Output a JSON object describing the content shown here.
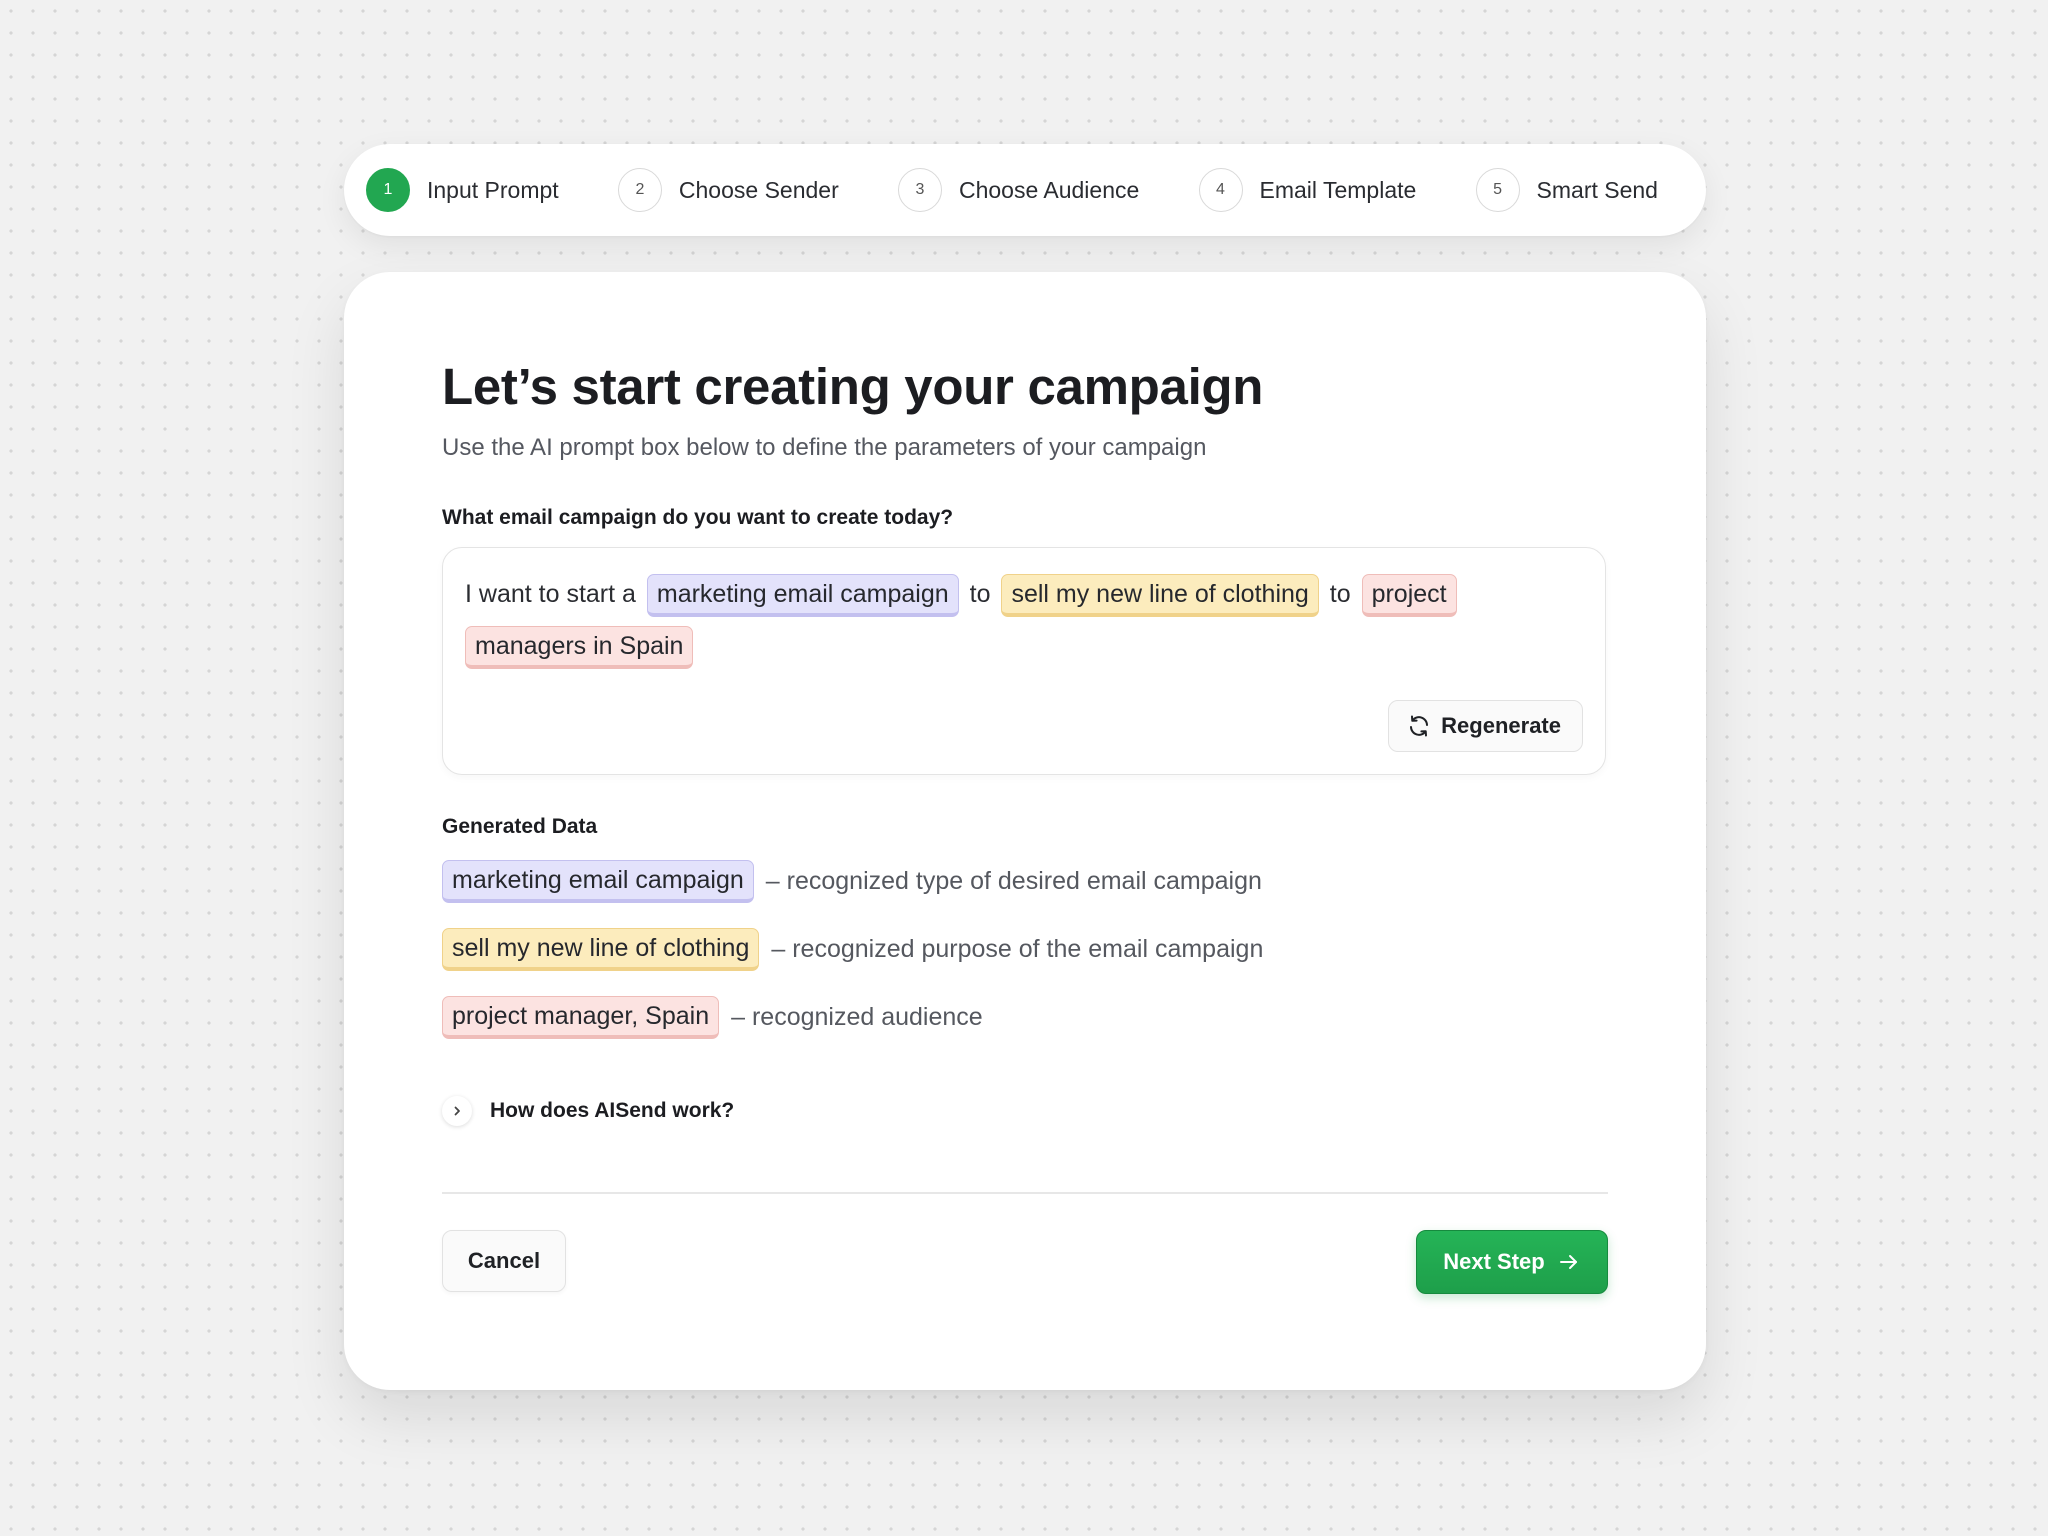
{
  "stepper": {
    "steps": [
      {
        "num": "1",
        "label": "Input Prompt",
        "active": true
      },
      {
        "num": "2",
        "label": "Choose Sender",
        "active": false
      },
      {
        "num": "3",
        "label": "Choose Audience",
        "active": false
      },
      {
        "num": "4",
        "label": "Email Template",
        "active": false
      },
      {
        "num": "5",
        "label": "Smart Send",
        "active": false
      }
    ]
  },
  "main": {
    "title": "Let’s start creating your campaign",
    "subtitle": "Use the AI prompt box below to define the parameters of your campaign",
    "prompt_label": "What email campaign do you want to create today?",
    "prompt": {
      "intro": "I want to start a",
      "type_chip": "marketing email campaign",
      "connector_1": "to",
      "purpose_chip": "sell my new line of clothing",
      "connector_2": "to",
      "audience_chip_part1": "project",
      "audience_chip_part2": "managers in Spain"
    },
    "regenerate_label": "Regenerate",
    "generated_label": "Generated Data",
    "generated": [
      {
        "chip": "marketing email campaign",
        "desc": "– recognized type of desired email campaign",
        "color": "purple"
      },
      {
        "chip": "sell my new line of clothing",
        "desc": "– recognized purpose of the email campaign",
        "color": "yellow"
      },
      {
        "chip": "project manager, Spain",
        "desc": "– recognized audience",
        "color": "pink"
      }
    ],
    "faq_label": "How does AISend work?"
  },
  "footer": {
    "cancel_label": "Cancel",
    "next_label": "Next Step"
  },
  "colors": {
    "accent_green": "#22a751",
    "chip_purple": "#e3e2fb",
    "chip_yellow": "#fcecbd",
    "chip_pink": "#fce3e1"
  },
  "icons": {
    "regenerate": "refresh-icon",
    "faq": "chevron-right-icon",
    "next": "arrow-right-icon"
  }
}
